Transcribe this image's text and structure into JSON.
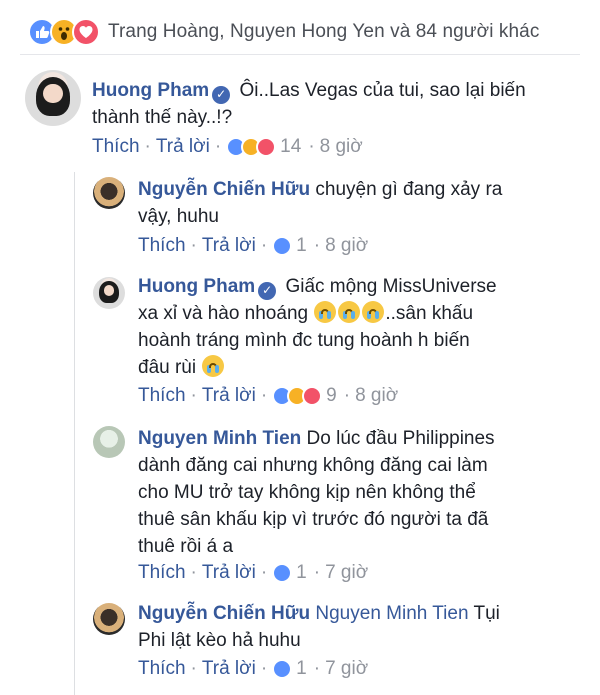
{
  "summary": {
    "reactors_text": "Trang Hoàng, Nguyen Hong Yen và 84 người khác",
    "reaction_types": [
      "like-icon",
      "wow-icon",
      "love-icon"
    ]
  },
  "comments": [
    {
      "author": "Huong Pham",
      "verified": true,
      "text_line1": "Ôi..Las Vegas của tui, sao lại biến",
      "text_line2": "thành thế này..!?",
      "like_label": "Thích",
      "reply_label": "Trả lời",
      "reaction_count": "14",
      "time": "8 giờ"
    },
    {
      "author": "Nguyễn Chiến Hữu",
      "text_line1": "chuyện gì đang xảy ra",
      "text_line2": "vậy, huhu",
      "like_label": "Thích",
      "reply_label": "Trả lời",
      "reaction_count": "1",
      "time": "8 giờ"
    },
    {
      "author": "Huong Pham",
      "verified": true,
      "text_line1": "Giấc mộng MissUniverse",
      "text_line2a": "xa xỉ và hào nhoáng",
      "text_line2b": "..sân khấu",
      "text_line3": "hoành tráng mình đc tung hoành h biến",
      "text_line4": "đâu rùi",
      "like_label": "Thích",
      "reply_label": "Trả lời",
      "reaction_count": "9",
      "time": "8 giờ"
    },
    {
      "author": "Nguyen Minh Tien",
      "text_line1": "Do lúc đầu Philippines",
      "text_line2": "dành đăng cai nhưng không đăng cai làm",
      "text_line3": "cho MU trở tay không kịp nên không thể",
      "text_line4": "thuê sân khấu kịp vì trước đó người ta đã",
      "text_line5": "thuê rồi á a",
      "like_label": "Thích",
      "reply_label": "Trả lời",
      "reaction_count": "1",
      "time": "7 giờ"
    },
    {
      "author": "Nguyễn Chiến Hữu",
      "mention": "Nguyen Minh Tien",
      "text_line1": "Tụi",
      "text_line2": "Phi lật kèo hả huhu",
      "like_label": "Thích",
      "reply_label": "Trả lời",
      "reaction_count": "1",
      "time": "7 giờ"
    }
  ],
  "colors": {
    "link": "#365899",
    "meta": "#90949c",
    "like": "#5890ff",
    "love": "#f25268",
    "wow": "#f7b125"
  }
}
